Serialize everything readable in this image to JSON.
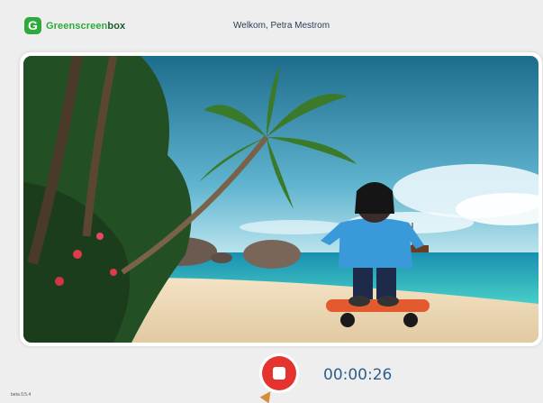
{
  "app": {
    "logo_letter": "G",
    "logo_text_a": "Greenscreen",
    "logo_text_b": "box",
    "welcome": "Welkom, Petra Mestrom"
  },
  "preview": {
    "scene": "tropical beach with palm trees, character on skateboard"
  },
  "controls": {
    "record_icon": "stop-record-icon",
    "timer": "00:00:26"
  },
  "footer": {
    "version": "beta 0.5.4"
  },
  "colors": {
    "brand_green": "#2eaa3c",
    "record_red": "#e5332f",
    "timer_blue": "#2e5f8c"
  }
}
